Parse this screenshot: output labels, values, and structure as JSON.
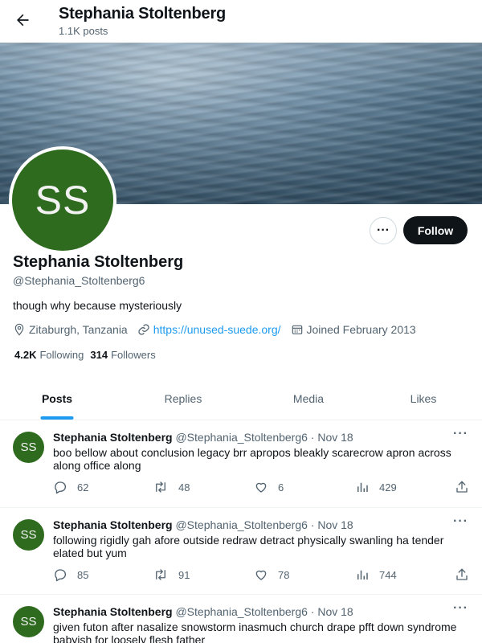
{
  "header": {
    "name": "Stephania Stoltenberg",
    "posts_count": "1.1K posts"
  },
  "profile": {
    "avatar_initials": "SS",
    "name": "Stephania Stoltenberg",
    "handle": "@Stephania_Stoltenberg6",
    "bio": "though why because mysteriously",
    "location": "Zitaburgh, Tanzania",
    "website": "https://unused-suede.org/",
    "joined": "Joined February 2013",
    "following_count": "4.2K",
    "following_label": "Following",
    "followers_count": "314",
    "followers_label": "Followers",
    "more_label": "···",
    "follow_label": "Follow"
  },
  "tabs": [
    {
      "label": "Posts"
    },
    {
      "label": "Replies"
    },
    {
      "label": "Media"
    },
    {
      "label": "Likes"
    }
  ],
  "posts": [
    {
      "avatar": "SS",
      "name": "Stephania Stoltenberg",
      "meta": "@Stephania_Stoltenberg6 · Nov 18",
      "text": "boo bellow about conclusion legacy brr apropos bleakly scarecrow apron across along office along",
      "replies": "62",
      "reposts": "48",
      "likes": "6",
      "views": "429",
      "more": "···"
    },
    {
      "avatar": "SS",
      "name": "Stephania Stoltenberg",
      "meta": "@Stephania_Stoltenberg6 · Nov 18",
      "text": "following rigidly gah afore outside redraw detract physically swanling ha tender elated but yum",
      "replies": "85",
      "reposts": "91",
      "likes": "78",
      "views": "744",
      "more": "···"
    },
    {
      "avatar": "SS",
      "name": "Stephania Stoltenberg",
      "meta": "@Stephania_Stoltenberg6 · Nov 18",
      "text": "given futon after nasalize snowstorm inasmuch church drape pfft down syndrome babyish for loosely flesh father",
      "more": "···"
    }
  ],
  "colors": {
    "accent": "#1d9bf0",
    "avatar_bg": "#2e6b1f",
    "text": "#0f1419",
    "muted": "#536471"
  }
}
